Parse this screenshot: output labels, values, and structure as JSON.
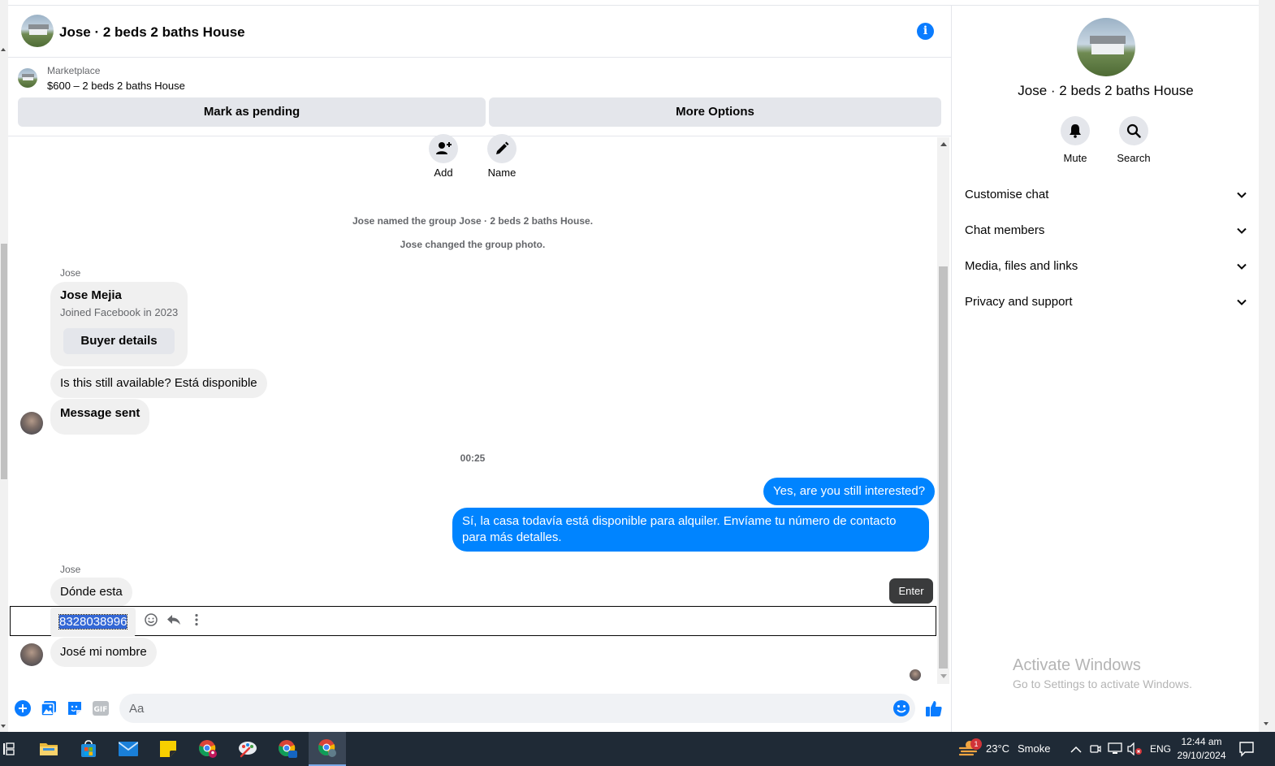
{
  "chat": {
    "title": "Jose · 2 beds 2 baths House",
    "marketplace_label": "Marketplace",
    "listing": "$600 – 2 beds 2 baths House",
    "mark_pending": "Mark as pending",
    "more_options": "More Options",
    "add_label": "Add",
    "name_label": "Name",
    "system_messages": [
      "Jose named the group Jose · 2 beds 2 baths House.",
      "Jose changed the group photo."
    ],
    "sender": "Jose",
    "card": {
      "name": "Jose Mejia",
      "subtitle": "Joined Facebook in 2023",
      "button": "Buyer details"
    },
    "incoming_1": "Is this still available?  Está disponible",
    "incoming_2": "Message sent",
    "timestamp": "00:25",
    "outgoing_1": "Yes, are you still interested?",
    "outgoing_2": "Sí, la casa todavía está disponible para alquiler. Envíame tu número de contacto para más detalles.",
    "sender_2": "Jose",
    "incoming_3": "Dónde esta",
    "incoming_4_selected": "8328038996",
    "incoming_5": "José mi nombre",
    "tooltip": "Enter",
    "composer_placeholder": "Aa"
  },
  "right_panel": {
    "title": "Jose · 2 beds 2 baths House",
    "mute_label": "Mute",
    "search_label": "Search",
    "sections": [
      "Customise chat",
      "Chat members",
      "Media, files and links",
      "Privacy and support"
    ],
    "watermark_title": "Activate Windows",
    "watermark_sub": "Go to Settings to activate Windows."
  },
  "taskbar": {
    "weather_temp": "23°C",
    "weather_desc": "Smoke",
    "weather_badge": "1",
    "language": "ENG",
    "time": "12:44 am",
    "date": "29/10/2024"
  },
  "colors": {
    "messenger_blue": "#0084ff",
    "accent_blue": "#0a7cff",
    "bubble_gray": "#f0f0f0",
    "taskbar": "#1f2a36"
  },
  "icons": [
    "info-icon",
    "add-person-icon",
    "pencil-icon",
    "bell-icon",
    "search-icon",
    "chevron-down-icon",
    "emoji-icon",
    "reply-icon",
    "more-vertical-icon",
    "plus-circle-icon",
    "photo-icon",
    "sticker-icon",
    "gif-icon",
    "like-icon"
  ]
}
